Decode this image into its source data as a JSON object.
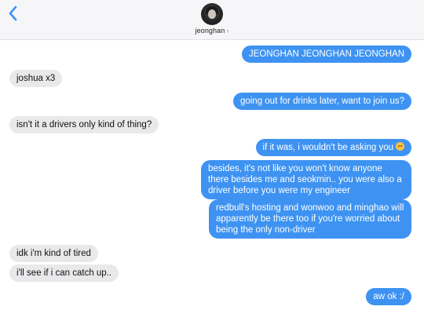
{
  "header": {
    "contact_name": "jeonghan",
    "chevron": "›",
    "back_icon": "chevron-left-icon",
    "accent_color": "#3e93f2"
  },
  "messages": [
    {
      "side": "out",
      "text": "JEONGHAN JEONGHAN JEONGHAN"
    },
    {
      "side": "in",
      "text": "joshua x3"
    },
    {
      "side": "out",
      "text": "going out for drinks later, want to join us?"
    },
    {
      "side": "in",
      "text": "isn't it a drivers only kind of thing?"
    },
    {
      "side": "out",
      "text": "if it was, i wouldn't be asking you",
      "emoji": "smirk-emoji-icon"
    },
    {
      "side": "out",
      "text": "besides, it's not like you won't know anyone there besides me and seokmin.. you were also a driver before you were my engineer"
    },
    {
      "side": "out",
      "text": "redbull's hosting and wonwoo and minghao will apparently be there too if you're worried about being the only non-driver"
    },
    {
      "side": "in",
      "text": "idk i'm kind of tired"
    },
    {
      "side": "in",
      "text": "i'll see if i can catch up.."
    },
    {
      "side": "out",
      "text": "aw ok :/"
    }
  ]
}
